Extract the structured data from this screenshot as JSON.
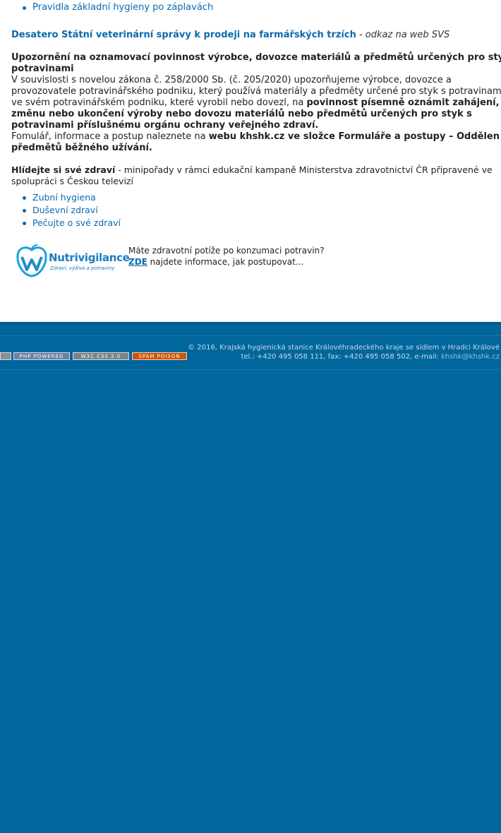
{
  "top_links": [
    "Pravidla základní hygieny po záplavách"
  ],
  "svs": {
    "link": "Desatero Státní veterinární správy k prodeji na farmářských trzích",
    "suffix": "- odkaz na web SVS"
  },
  "notice": {
    "heading_line1": "Upozornění na oznamovací povinnost výrobce, dovozce materiálů a předmětů určených pro sty",
    "heading_line2": "potravinami",
    "p1_line1": "V souvislosti s novelou zákona č. 258/2000 Sb. (č. 205/2020) upozorňujeme výrobce, dovozce a",
    "p1_line2": "provozovatele potravinářského podniku, který používá materiály a předměty určené pro styk s potravinam",
    "p1_line3_a": "ve svém potravinářském podniku, které vyrobil nebo dovezl, na ",
    "p1_line3_b": "povinnost písemně oznámit zahájení,",
    "p1_line4": "změnu nebo ukončení výroby nebo dovozu materiálů nebo předmětů určených pro styk s",
    "p1_line5": "potravinami příslušnému orgánu ochrany veřejného zdraví.",
    "p2_line1_a": "Fomulář, informace a postup naleznete na ",
    "p2_line1_b": "webu khshk.cz ve složce Formuláře a postupy – Oddělen",
    "p2_line2": "předmětů běžného užívání."
  },
  "health": {
    "title": "Hlídejte si své zdraví",
    "desc_line1": " - minipořady v rámci edukační kampaně Ministerstva zdravotnictví ČR připravené ve",
    "desc_line2": "spolupráci s Českou televizí",
    "links": [
      "Zubní hygiena",
      "Duševní zdraví",
      "Pečujte o své zdraví"
    ]
  },
  "nutri": {
    "logo_name": "Nutrivigilance",
    "logo_tagline": "Zdraví, výživa a potraviny",
    "question": "Máte zdravotní potíže po konzumaci potravin?",
    "link": "ZDE",
    "rest": " najdete informace, jak postupovat..."
  },
  "footer": {
    "badges": [
      {
        "label": "PHP POWERED",
        "color": "#6d7fa7"
      },
      {
        "label": "W3C CSS 2.0",
        "color": "#7d8287"
      },
      {
        "label": "SPAM POISON",
        "color": "#d35400"
      }
    ],
    "copyright": "© 2016, Krajská hygienická stanice Královéhradeckého kraje se sídlem v Hradci Králové",
    "contact": "tel.: +420 495 058 111, fax: +420 495 058 502, e-mail: ",
    "email": "khshk@khshk.cz"
  }
}
